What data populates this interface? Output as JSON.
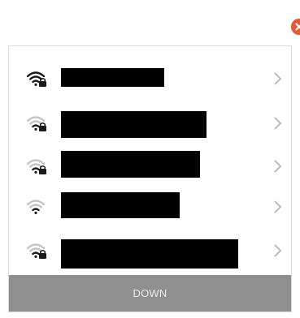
{
  "close_icon": "close-icon",
  "networks": [
    {
      "signal_level": 1.0,
      "secured": true,
      "icon": "wifi-locked-icon"
    },
    {
      "signal_level": 0.25,
      "secured": true,
      "icon": "wifi-locked-icon"
    },
    {
      "signal_level": 0.25,
      "secured": true,
      "icon": "wifi-locked-icon"
    },
    {
      "signal_level": 0.5,
      "secured": false,
      "icon": "wifi-icon"
    },
    {
      "signal_level": 0.25,
      "secured": true,
      "icon": "wifi-locked-icon"
    }
  ],
  "row_chevron_icon": "chevron-right-icon",
  "down_button": {
    "label": "DOWN"
  },
  "colors": {
    "close": "#e25a3a",
    "down_button_bg": "#8f8f8f",
    "down_button_text": "#e8e8e8",
    "chevron": "#b3b3b3",
    "wifi_strong": "#1a1a1a",
    "wifi_weak": "#c4c4c4",
    "redaction": "#000000"
  }
}
